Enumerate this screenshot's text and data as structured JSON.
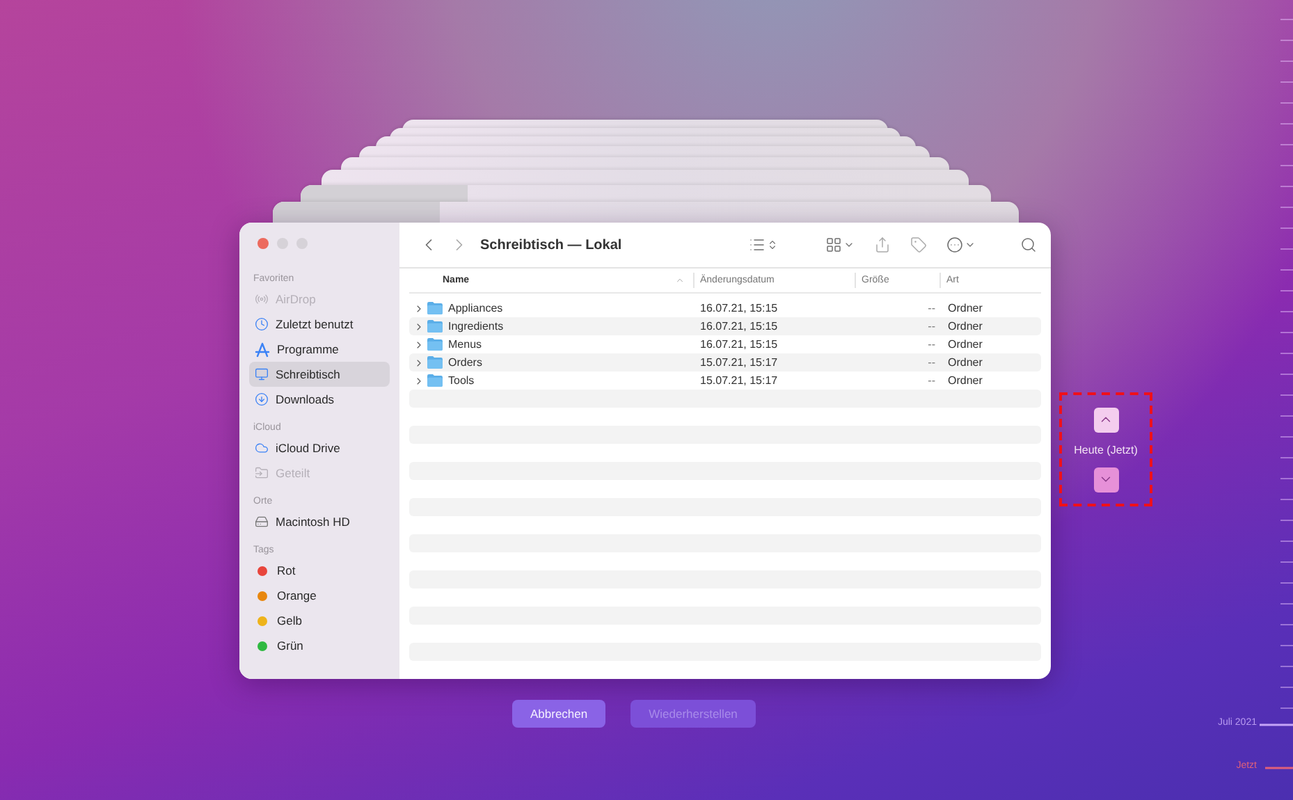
{
  "window": {
    "title": "Schreibtisch — Lokal"
  },
  "sidebar": [
    {
      "heading": "Favoriten",
      "items": [
        {
          "label": "AirDrop",
          "kind": "airdrop",
          "selected": false,
          "disabled": true
        },
        {
          "label": "Zuletzt benutzt",
          "kind": "recent",
          "selected": false,
          "disabled": false
        },
        {
          "label": "Programme",
          "kind": "apps",
          "selected": false,
          "disabled": false
        },
        {
          "label": "Schreibtisch",
          "kind": "desktop",
          "selected": true,
          "disabled": false
        },
        {
          "label": "Downloads",
          "kind": "downloads",
          "selected": false,
          "disabled": false
        }
      ]
    },
    {
      "heading": "iCloud",
      "items": [
        {
          "label": "iCloud Drive",
          "kind": "cloud",
          "selected": false,
          "disabled": false
        },
        {
          "label": "Geteilt",
          "kind": "shared",
          "selected": false,
          "disabled": true
        }
      ]
    },
    {
      "heading": "Orte",
      "items": [
        {
          "label": "Macintosh HD",
          "kind": "disk",
          "selected": false,
          "disabled": false
        }
      ]
    },
    {
      "heading": "Tags",
      "items": [
        {
          "label": "Rot",
          "kind": "tag",
          "color": "#e8453c",
          "selected": false,
          "disabled": false
        },
        {
          "label": "Orange",
          "kind": "tag",
          "color": "#e8870e",
          "selected": false,
          "disabled": false
        },
        {
          "label": "Gelb",
          "kind": "tag",
          "color": "#eeb31a",
          "selected": false,
          "disabled": false
        },
        {
          "label": "Grün",
          "kind": "tag",
          "color": "#2fb941",
          "selected": false,
          "disabled": false
        }
      ]
    }
  ],
  "columns": [
    {
      "label": "Name",
      "sorted": true
    },
    {
      "label": "Änderungsdatum",
      "sorted": false
    },
    {
      "label": "Größe",
      "sorted": false
    },
    {
      "label": "Art",
      "sorted": false
    }
  ],
  "rows": [
    {
      "name": "Appliances",
      "modified": "16.07.21, 15:15",
      "size": "--",
      "art": "Ordner",
      "expanded": false
    },
    {
      "name": "Ingredients",
      "modified": "16.07.21, 15:15",
      "size": "--",
      "art": "Ordner",
      "expanded": false
    },
    {
      "name": "Menus",
      "modified": "16.07.21, 15:15",
      "size": "--",
      "art": "Ordner",
      "expanded": false
    },
    {
      "name": "Orders",
      "modified": "15.07.21, 15:17",
      "size": "--",
      "art": "Ordner",
      "expanded": false
    },
    {
      "name": "Tools",
      "modified": "15.07.21, 15:17",
      "size": "--",
      "art": "Ordner",
      "expanded": false
    }
  ],
  "time_nav": {
    "label": "Heute (Jetzt)"
  },
  "timeline": [
    {
      "label": "Juli 2021",
      "kind": "month"
    },
    {
      "label": "Jetzt",
      "kind": "now"
    }
  ],
  "buttons": [
    {
      "label": "Abbrechen",
      "disabled": false
    },
    {
      "label": "Wiederherstellen",
      "disabled": true
    }
  ]
}
